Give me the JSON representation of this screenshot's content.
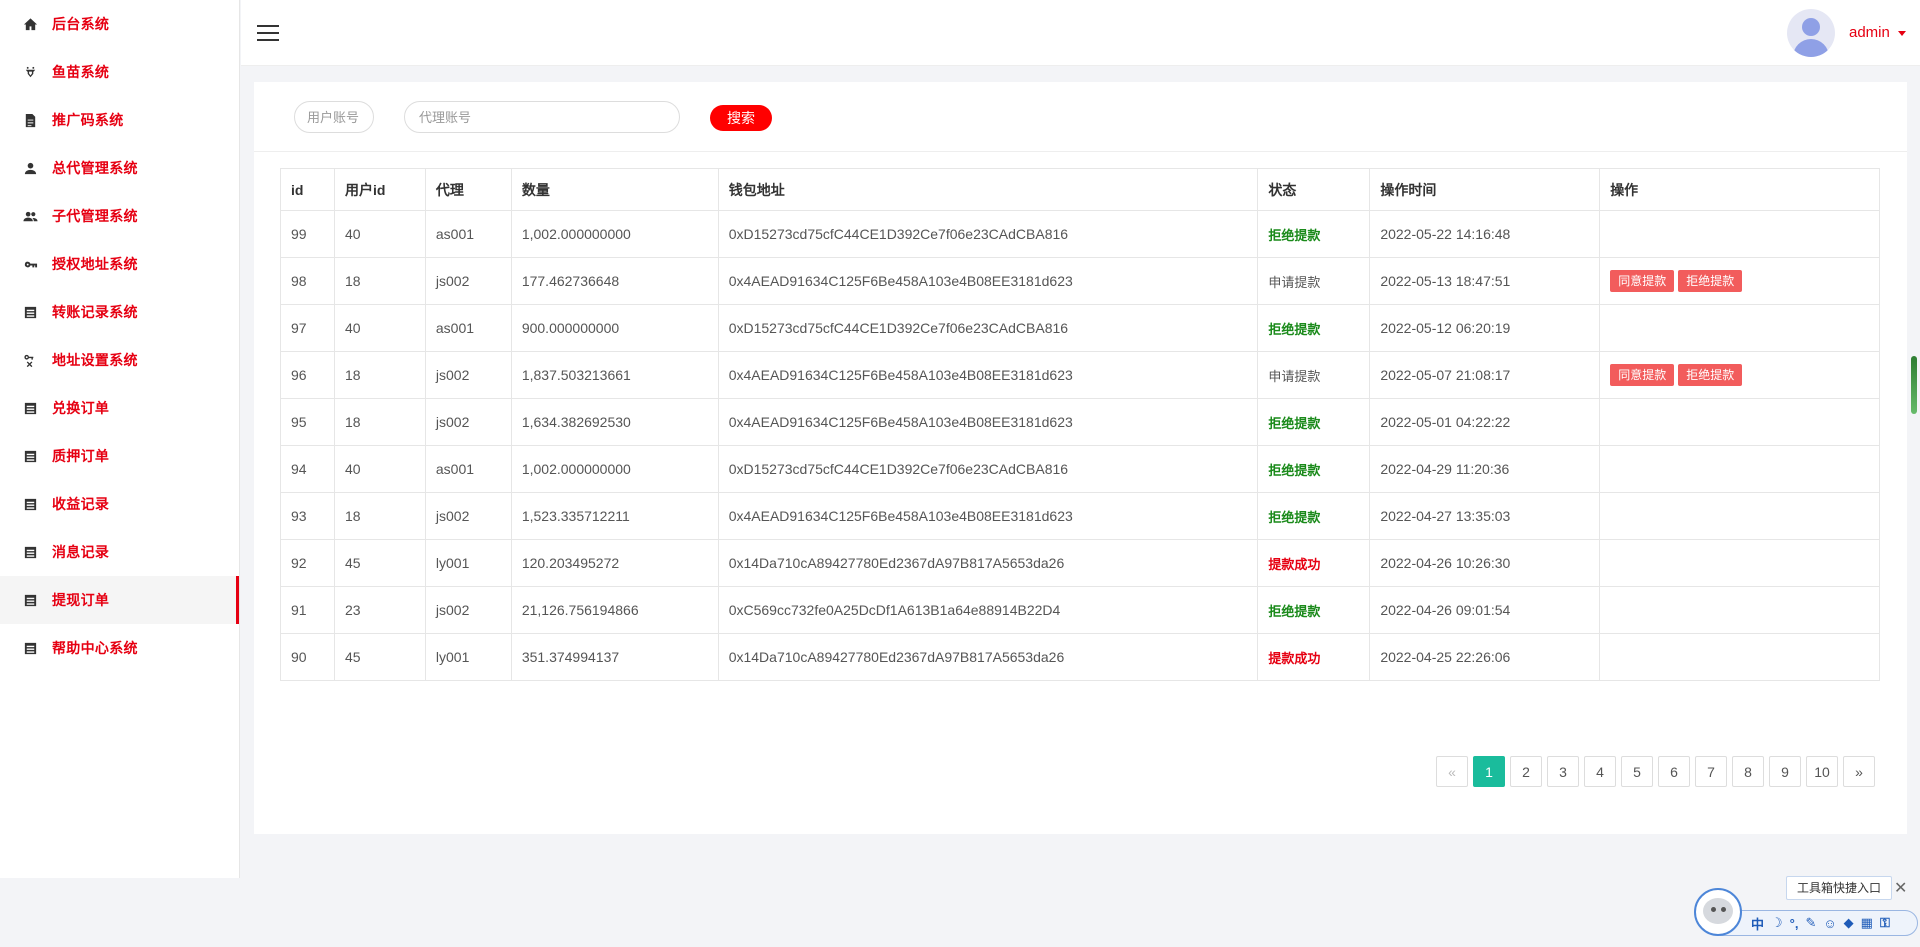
{
  "sidebar": {
    "items": [
      {
        "label": "后台系统",
        "icon": "home-icon"
      },
      {
        "label": "鱼苗系统",
        "icon": "fish-icon"
      },
      {
        "label": "推广码系统",
        "icon": "document-icon"
      },
      {
        "label": "总代管理系统",
        "icon": "user-icon"
      },
      {
        "label": "子代管理系统",
        "icon": "users-icon"
      },
      {
        "label": "授权地址系统",
        "icon": "key-icon"
      },
      {
        "label": "转账记录系统",
        "icon": "list-icon"
      },
      {
        "label": "地址设置系统",
        "icon": "key-settings-icon"
      },
      {
        "label": "兑换订单",
        "icon": "list-icon"
      },
      {
        "label": "质押订单",
        "icon": "list-icon"
      },
      {
        "label": "收益记录",
        "icon": "list-icon"
      },
      {
        "label": "消息记录",
        "icon": "list-icon"
      },
      {
        "label": "提现订单",
        "icon": "list-icon"
      },
      {
        "label": "帮助中心系统",
        "icon": "list-icon"
      }
    ]
  },
  "header": {
    "username": "admin"
  },
  "search": {
    "user_placeholder": "用户账号",
    "agent_placeholder": "代理账号",
    "button_label": "搜索"
  },
  "table": {
    "headers": [
      "id",
      "用户id",
      "代理",
      "数量",
      "钱包地址",
      "状态",
      "操作时间",
      "操作"
    ],
    "rows": [
      {
        "id": "99",
        "uid": "40",
        "agent": "as001",
        "amount": "1,002.000000000",
        "wallet": "0xD15273cd75cfC44CE1D392Ce7f06e23CAdCBA816",
        "status": "拒绝提款",
        "status_type": "reject",
        "time": "2022-05-22 14:16:48",
        "actions": []
      },
      {
        "id": "98",
        "uid": "18",
        "agent": "js002",
        "amount": "177.462736648",
        "wallet": "0x4AEAD91634C125F6Be458A103e4B08EE3181d623",
        "status": "申请提款",
        "status_type": "apply",
        "time": "2022-05-13 18:47:51",
        "actions": [
          "同意提款",
          "拒绝提款"
        ]
      },
      {
        "id": "97",
        "uid": "40",
        "agent": "as001",
        "amount": "900.000000000",
        "wallet": "0xD15273cd75cfC44CE1D392Ce7f06e23CAdCBA816",
        "status": "拒绝提款",
        "status_type": "reject",
        "time": "2022-05-12 06:20:19",
        "actions": []
      },
      {
        "id": "96",
        "uid": "18",
        "agent": "js002",
        "amount": "1,837.503213661",
        "wallet": "0x4AEAD91634C125F6Be458A103e4B08EE3181d623",
        "status": "申请提款",
        "status_type": "apply",
        "time": "2022-05-07 21:08:17",
        "actions": [
          "同意提款",
          "拒绝提款"
        ]
      },
      {
        "id": "95",
        "uid": "18",
        "agent": "js002",
        "amount": "1,634.382692530",
        "wallet": "0x4AEAD91634C125F6Be458A103e4B08EE3181d623",
        "status": "拒绝提款",
        "status_type": "reject",
        "time": "2022-05-01 04:22:22",
        "actions": []
      },
      {
        "id": "94",
        "uid": "40",
        "agent": "as001",
        "amount": "1,002.000000000",
        "wallet": "0xD15273cd75cfC44CE1D392Ce7f06e23CAdCBA816",
        "status": "拒绝提款",
        "status_type": "reject",
        "time": "2022-04-29 11:20:36",
        "actions": []
      },
      {
        "id": "93",
        "uid": "18",
        "agent": "js002",
        "amount": "1,523.335712211",
        "wallet": "0x4AEAD91634C125F6Be458A103e4B08EE3181d623",
        "status": "拒绝提款",
        "status_type": "reject",
        "time": "2022-04-27 13:35:03",
        "actions": []
      },
      {
        "id": "92",
        "uid": "45",
        "agent": "ly001",
        "amount": "120.203495272",
        "wallet": "0x14Da710cA89427780Ed2367dA97B817A5653da26",
        "status": "提款成功",
        "status_type": "success",
        "time": "2022-04-26 10:26:30",
        "actions": []
      },
      {
        "id": "91",
        "uid": "23",
        "agent": "js002",
        "amount": "21,126.756194866",
        "wallet": "0xC569cc732fe0A25DcDf1A613B1a64e88914B22D4",
        "status": "拒绝提款",
        "status_type": "reject",
        "time": "2022-04-26 09:01:54",
        "actions": []
      },
      {
        "id": "90",
        "uid": "45",
        "agent": "ly001",
        "amount": "351.374994137",
        "wallet": "0x14Da710cA89427780Ed2367dA97B817A5653da26",
        "status": "提款成功",
        "status_type": "success",
        "time": "2022-04-25 22:26:06",
        "actions": []
      }
    ]
  },
  "pagination": {
    "prev": "«",
    "next": "»",
    "pages": [
      "1",
      "2",
      "3",
      "4",
      "5",
      "6",
      "7",
      "8",
      "9",
      "10"
    ],
    "current": "1"
  },
  "ime_widget": {
    "tooltip": "工具箱快捷入口",
    "close": "✕",
    "glyphs": [
      "中",
      "☽",
      "°,",
      "✎",
      "☺",
      "◆",
      "▦",
      "⚿"
    ]
  },
  "colors": {
    "accent": "#e60012",
    "search_button": "#ff0000",
    "reject_status": "#1a8a1a",
    "success_status": "#e60012",
    "action_button": "#f25c5c",
    "page_active": "#1abc9c"
  }
}
